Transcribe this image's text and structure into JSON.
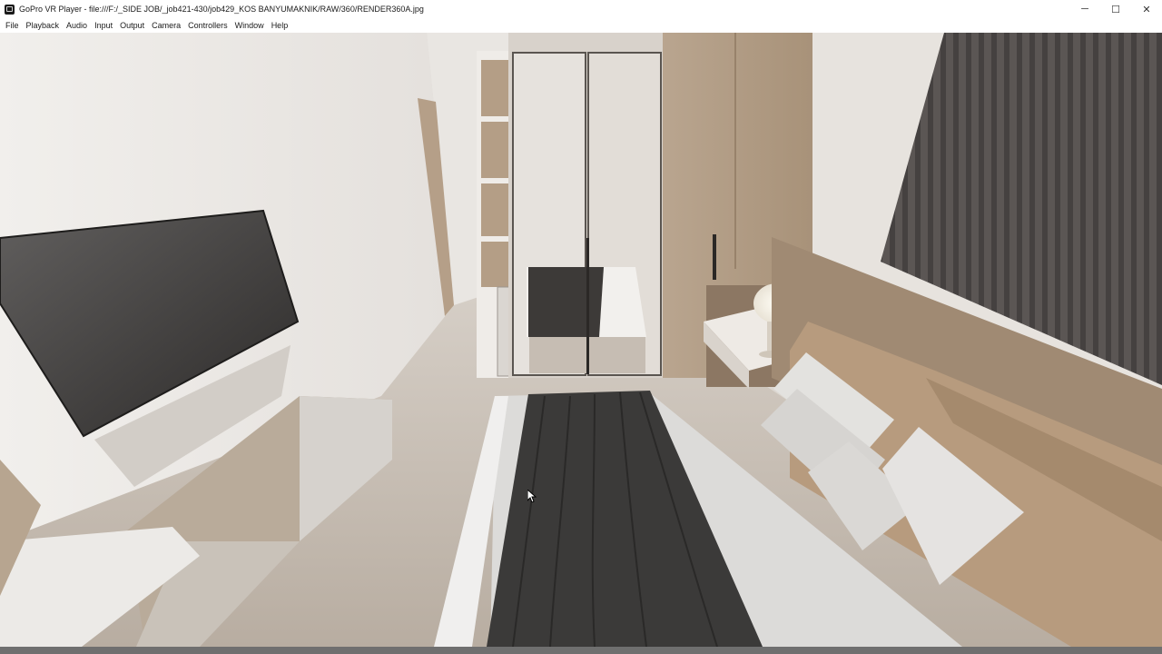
{
  "window": {
    "title": "GoPro VR Player - file:///F:/_SIDE JOB/_job421-430/job429_KOS BANYUMAKNIK/RAW/360/RENDER360A.jpg",
    "controls": {
      "minimize": "─",
      "maximize": "☐",
      "close": "✕"
    }
  },
  "menu": {
    "items": [
      "File",
      "Playback",
      "Audio",
      "Input",
      "Output",
      "Camera",
      "Controllers",
      "Window",
      "Help"
    ]
  },
  "viewer": {
    "icon": "arrow-cursor-icon"
  }
}
